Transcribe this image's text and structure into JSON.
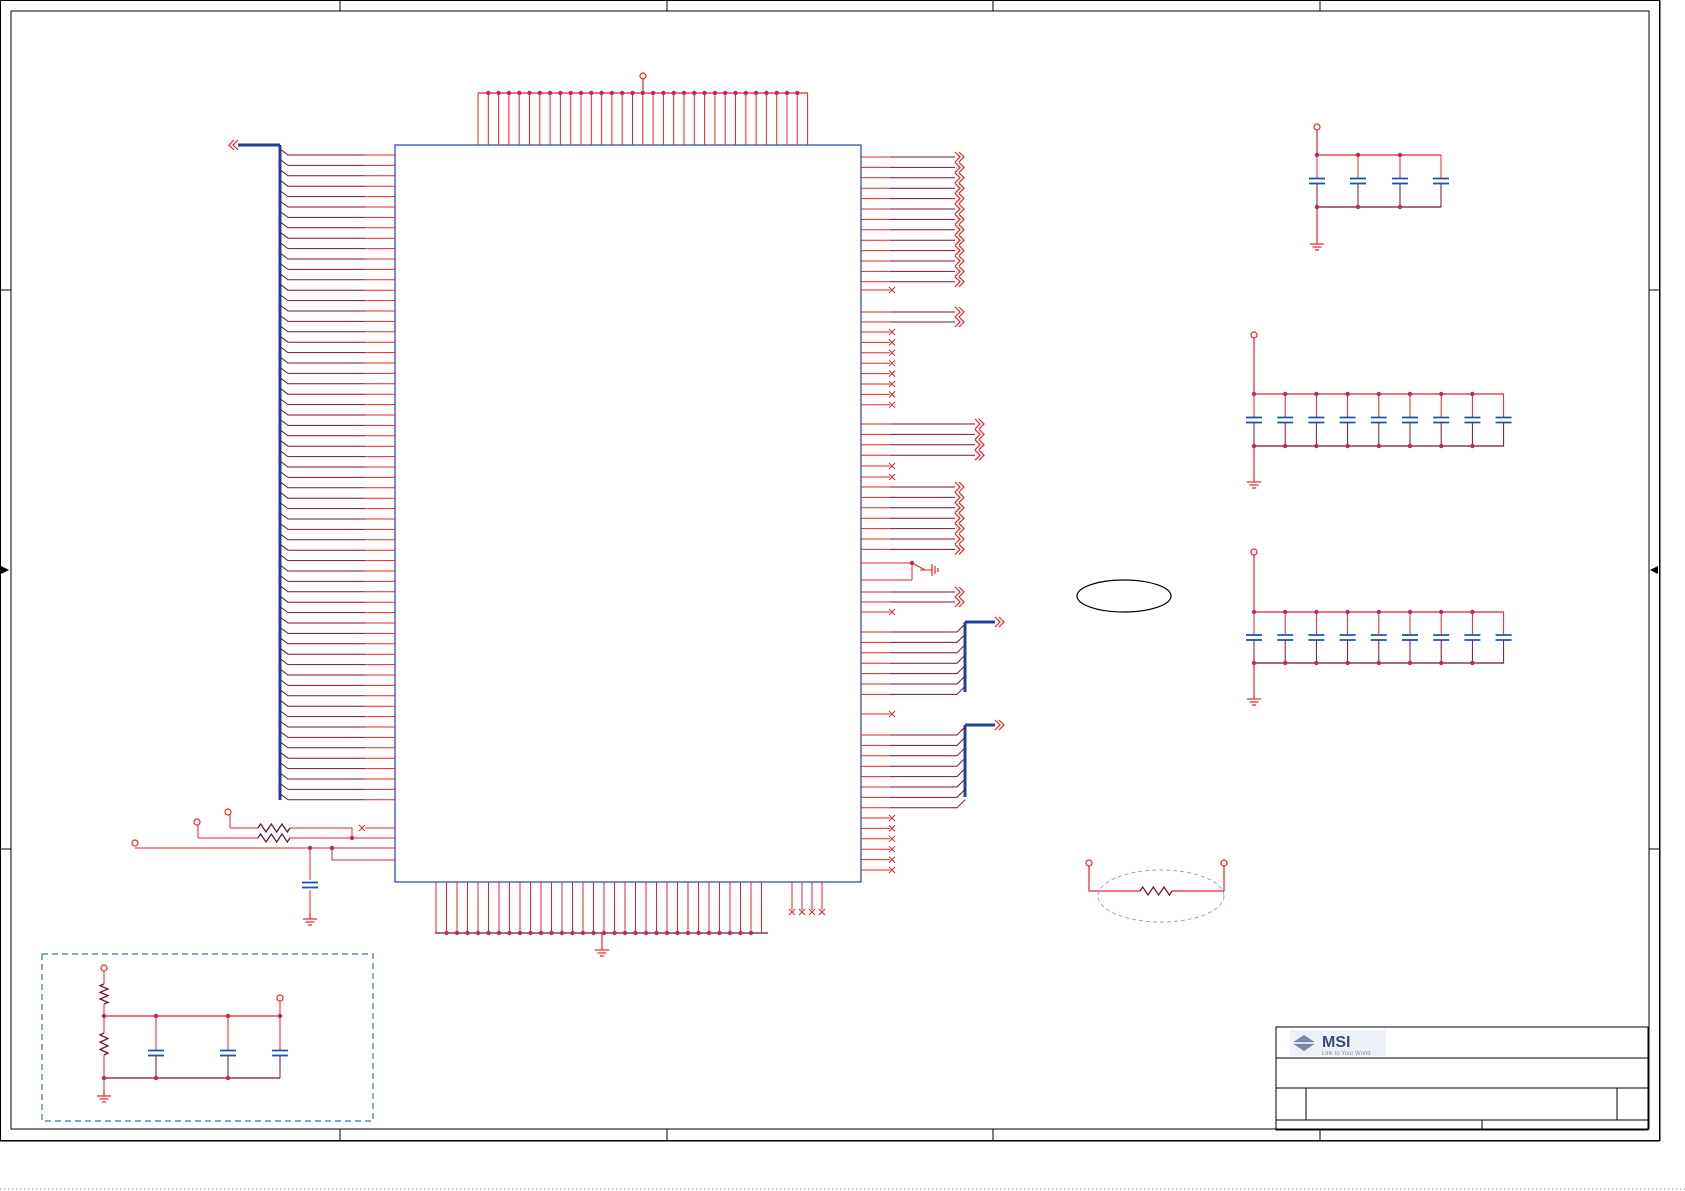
{
  "logo": {
    "brand": "MSI",
    "tagline": "Link to Your World"
  },
  "colors": {
    "wire": "#e8232a",
    "pin": "#7a1030",
    "node": "#b8286a",
    "bus": "#2240a0",
    "body": "#2040b0",
    "cap": "#1a55b0",
    "frame": "#000000",
    "dash": "#3a6fc0",
    "ellipse_dash": "#8fa8c8"
  },
  "icons": {
    "power_symbol": "circle-terminal-icon",
    "ground_symbol": "ground-icon",
    "offpage_connector": "double-chevron-icon",
    "no_connect": "x-mark-icon"
  }
}
